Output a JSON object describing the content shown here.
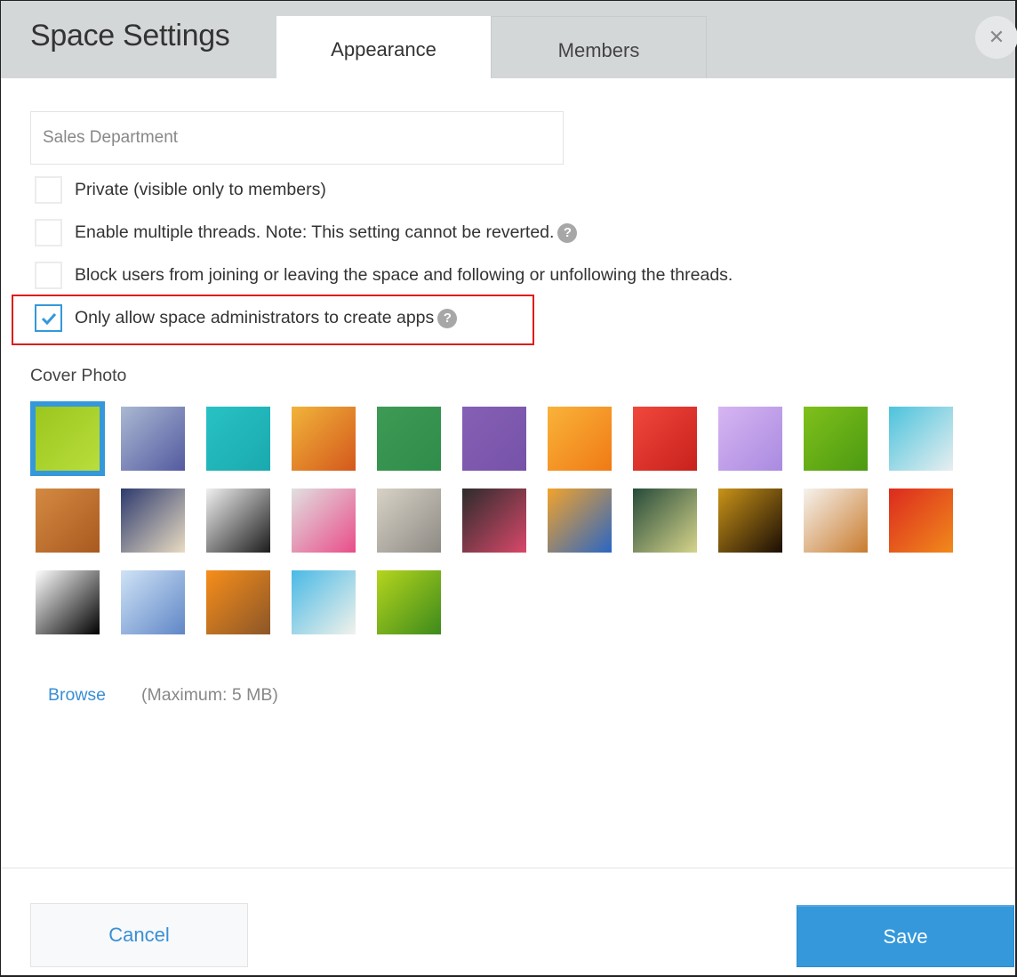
{
  "dialog": {
    "title": "Space Settings",
    "close_icon": "close-icon",
    "tabs": [
      {
        "label": "Appearance",
        "active": true
      },
      {
        "label": "Members",
        "active": false
      }
    ]
  },
  "form": {
    "space_name_value": "Sales Department",
    "options": [
      {
        "label": "Private (visible only to members)",
        "checked": false,
        "help": false
      },
      {
        "label": "Enable multiple threads. Note: This setting cannot be reverted.",
        "checked": false,
        "help": true
      },
      {
        "label": "Block users from joining or leaving the space and following or unfollowing the threads.",
        "checked": false,
        "help": false
      },
      {
        "label": "Only allow space administrators to create apps",
        "checked": true,
        "help": true,
        "highlighted": true
      }
    ],
    "help_glyph": "?"
  },
  "cover_photo": {
    "label": "Cover Photo",
    "selected_index": 0,
    "thumbnails": [
      {
        "name": "green-curves",
        "colors": [
          "#9bc71d",
          "#b9dd3d"
        ]
      },
      {
        "name": "blue-lavender-gradient",
        "colors": [
          "#aab8d2",
          "#545aa0"
        ]
      },
      {
        "name": "turquoise-paint",
        "colors": [
          "#28c2c4",
          "#1aa9ae"
        ]
      },
      {
        "name": "orange-grunge",
        "colors": [
          "#f1b43a",
          "#d4581c"
        ]
      },
      {
        "name": "green-texture",
        "colors": [
          "#3d9b55",
          "#2f8c4a"
        ]
      },
      {
        "name": "purple-texture",
        "colors": [
          "#8560b5",
          "#7652a8"
        ]
      },
      {
        "name": "orange-lily",
        "colors": [
          "#f9b33a",
          "#f07a15"
        ]
      },
      {
        "name": "red-carnation",
        "colors": [
          "#f0483c",
          "#c8201c"
        ]
      },
      {
        "name": "lilac-flower",
        "colors": [
          "#d7b5f2",
          "#a98ae0"
        ]
      },
      {
        "name": "green-leaf",
        "colors": [
          "#7fc01b",
          "#4c9a12"
        ]
      },
      {
        "name": "blue-cubes",
        "colors": [
          "#4bc3dc",
          "#e8eef0"
        ]
      },
      {
        "name": "wooden-weave",
        "colors": [
          "#d48a42",
          "#a9591f"
        ]
      },
      {
        "name": "mosaic-tiles",
        "colors": [
          "#2d3a6e",
          "#e9dcc2"
        ]
      },
      {
        "name": "compass",
        "colors": [
          "#f0f0f0",
          "#1c1c1c"
        ]
      },
      {
        "name": "notebooks",
        "colors": [
          "#e0e0e0",
          "#e94d8a"
        ]
      },
      {
        "name": "gear",
        "colors": [
          "#d8d2c6",
          "#8d8a84"
        ]
      },
      {
        "name": "chalk-question-marks",
        "colors": [
          "#2c2c2c",
          "#d9486a"
        ]
      },
      {
        "name": "colored-pencils",
        "colors": [
          "#f2a32b",
          "#2a66c4"
        ]
      },
      {
        "name": "lightbulb-chalkboard",
        "colors": [
          "#264b3a",
          "#d6d48a"
        ]
      },
      {
        "name": "amber-bokeh",
        "colors": [
          "#c99318",
          "#1a0d05"
        ]
      },
      {
        "name": "latte-art",
        "colors": [
          "#f6f3ee",
          "#c97b2e"
        ]
      },
      {
        "name": "vegetables",
        "colors": [
          "#dc2a1e",
          "#f18a1c"
        ]
      },
      {
        "name": "cat-and-dog",
        "colors": [
          "#ffffff",
          "#000000"
        ]
      },
      {
        "name": "snowy-trees",
        "colors": [
          "#cfe3f6",
          "#5f86c6"
        ]
      },
      {
        "name": "pumpkins",
        "colors": [
          "#f78e1a",
          "#8b5628"
        ]
      },
      {
        "name": "palm-beach",
        "colors": [
          "#49b9e6",
          "#f2f2ea"
        ]
      },
      {
        "name": "bamboo",
        "colors": [
          "#b5d51d",
          "#3d8a1c"
        ]
      }
    ],
    "browse_label": "Browse",
    "max_size_note": "(Maximum: 5 MB)"
  },
  "footer": {
    "cancel_label": "Cancel",
    "save_label": "Save"
  },
  "colors": {
    "accent": "#3498db",
    "highlight_border": "#e01b1b",
    "header_bg": "#d4d7d8"
  }
}
